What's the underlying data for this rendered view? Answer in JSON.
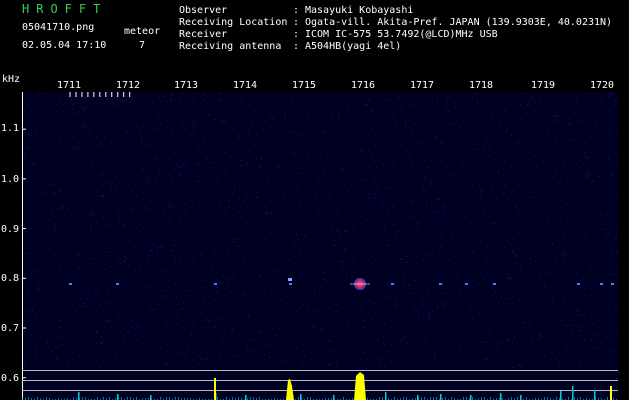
{
  "header": {
    "app_title": "HROFFT",
    "filename": "05041710.png",
    "datetime": "02.05.04 17:10",
    "event_label": "meteor",
    "event_count": "7",
    "info": [
      {
        "label": "Observer",
        "sep": ":",
        "value": "Masayuki Kobayashi"
      },
      {
        "label": "Receiving Location",
        "sep": ":",
        "value": "Ogata-vill. Akita-Pref. JAPAN (139.9303E, 40.0231N)"
      },
      {
        "label": "Receiver",
        "sep": ":",
        "value": "ICOM IC-575 53.7492(@LCD)MHz USB"
      },
      {
        "label": "Receiving antenna",
        "sep": ":",
        "value": "A504HB(yagi 4el)"
      }
    ]
  },
  "spectrogram": {
    "unit": "kHz",
    "time_labels": [
      "1711",
      "1712",
      "1713",
      "1714",
      "1715",
      "1716",
      "1717",
      "1718",
      "1719",
      "1720"
    ],
    "freq_labels": [
      "1.1",
      "1.0",
      "0.9",
      "0.8",
      "0.7",
      "0.6"
    ],
    "colors": {
      "background": "#000022",
      "noise": "#1a2a88",
      "echo": "#5577ff",
      "meteor_core": "#ff3344",
      "level_cyan": "#00ccdd",
      "level_yellow": "#ffff00",
      "grid": "#ffffff"
    },
    "echo_minutes": [
      17.1,
      23.6,
      40.6,
      64.0,
      94.0,
      117.5,
      124.2,
      136.8,
      160.8,
      183.3,
      191.2,
      197.3
    ]
  }
}
